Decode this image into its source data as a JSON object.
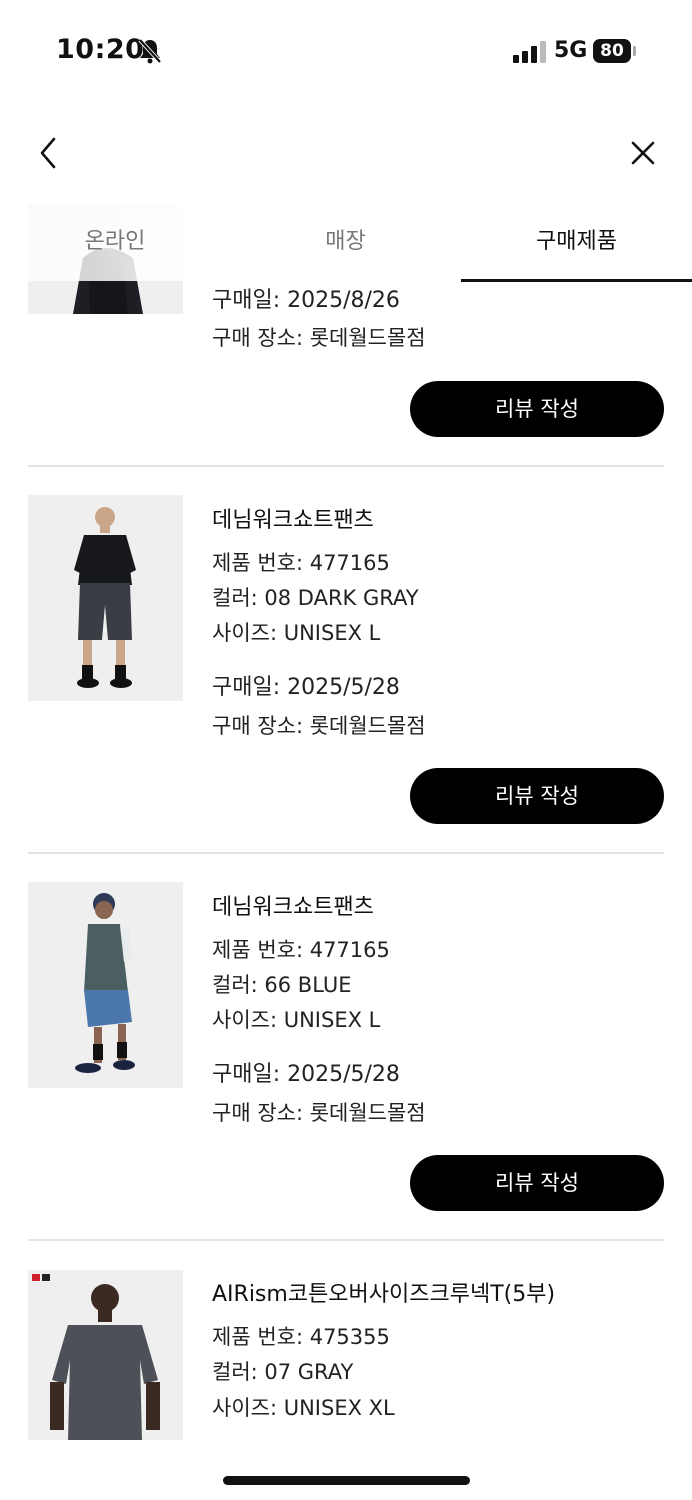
{
  "status_bar": {
    "time": "10:20",
    "network": "5G",
    "battery": "80"
  },
  "tabs": [
    {
      "label": "온라인",
      "active": false
    },
    {
      "label": "매장",
      "active": false
    },
    {
      "label": "구매제품",
      "active": true
    }
  ],
  "items": [
    {
      "purchase_date": "구매일: 2025/8/26",
      "store": "구매 장소: 롯데월드몰점",
      "review_label": "리뷰 작성"
    },
    {
      "name": "데님워크쇼트팬츠",
      "product_no": "제품 번호: 477165",
      "color": "컬러: 08 DARK GRAY",
      "size": "사이즈: UNISEX L",
      "purchase_date": "구매일: 2025/5/28",
      "store": "구매 장소: 롯데월드몰점",
      "review_label": "리뷰 작성"
    },
    {
      "name": "데님워크쇼트팬츠",
      "product_no": "제품 번호: 477165",
      "color": "컬러: 66 BLUE",
      "size": "사이즈: UNISEX L",
      "purchase_date": "구매일: 2025/5/28",
      "store": "구매 장소: 롯데월드몰점",
      "review_label": "리뷰 작성"
    },
    {
      "name": "AIRism코튼오버사이즈크루넥T(5부)",
      "product_no": "제품 번호: 475355",
      "color": "컬러: 07 GRAY",
      "size": "사이즈: UNISEX XL"
    }
  ],
  "colors": {
    "accent": "#000000",
    "divider": "#e3e3e3",
    "inactive_tab": "#777777"
  },
  "icons": {
    "back": "chevron-left-icon",
    "close": "close-icon",
    "bell": "bell-slash-icon"
  }
}
